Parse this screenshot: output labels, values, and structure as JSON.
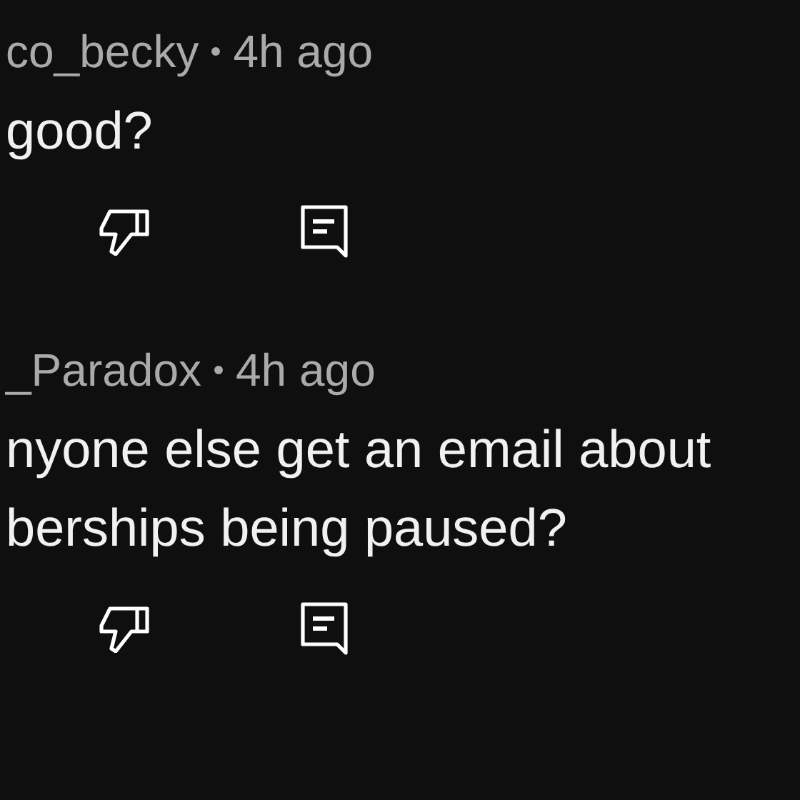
{
  "comments": [
    {
      "author": "co_becky",
      "time": "4h ago",
      "body": "good?"
    },
    {
      "author": "_Paradox",
      "time": "4h ago",
      "body": "nyone else get an email about berships being paused?"
    }
  ]
}
